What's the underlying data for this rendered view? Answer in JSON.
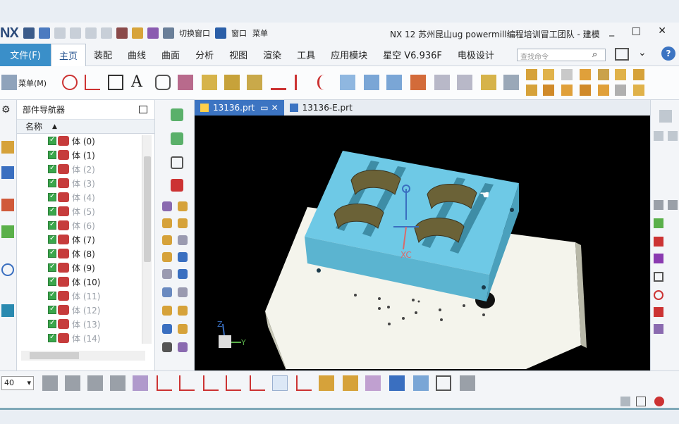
{
  "app": {
    "logo": "NX",
    "title": "NX 12 苏州昆山ug powermill编程培训冒工团队 - 建模",
    "quick_switch_window": "切换窗口",
    "quick_window": "窗口",
    "quick_menu": "菜单"
  },
  "menu": {
    "file": "文件(F)",
    "tabs": [
      "主页",
      "装配",
      "曲线",
      "曲面",
      "分析",
      "视图",
      "渲染",
      "工具",
      "应用模块",
      "星空 V6.936F",
      "电极设计"
    ],
    "active_tab": "主页",
    "search_placeholder": "查找命令"
  },
  "ribbon": {
    "menu_label": "菜单(M)"
  },
  "navigator": {
    "title": "部件导航器",
    "column_name": "名称",
    "rows": [
      {
        "label": "体 (0)",
        "gray": false
      },
      {
        "label": "体 (1)",
        "gray": false
      },
      {
        "label": "体 (2)",
        "gray": true
      },
      {
        "label": "体 (3)",
        "gray": true
      },
      {
        "label": "体 (4)",
        "gray": true
      },
      {
        "label": "体 (5)",
        "gray": true
      },
      {
        "label": "体 (6)",
        "gray": true
      },
      {
        "label": "体 (7)",
        "gray": false
      },
      {
        "label": "体 (8)",
        "gray": false
      },
      {
        "label": "体 (9)",
        "gray": false
      },
      {
        "label": "体 (10)",
        "gray": false
      },
      {
        "label": "体 (11)",
        "gray": true
      },
      {
        "label": "体 (12)",
        "gray": true
      },
      {
        "label": "体 (13)",
        "gray": true
      },
      {
        "label": "体 (14)",
        "gray": true
      }
    ]
  },
  "documents": {
    "tabs": [
      "13136.prt",
      "13136-E.prt"
    ],
    "active": "13136.prt"
  },
  "viewport": {
    "xc_label": "XC",
    "axis_z": "Z",
    "axis_y": "Y"
  },
  "bottom": {
    "zoom_value": "40"
  },
  "colors": {
    "file_button": "#3a8fc9",
    "mold_plate": "#6ec9e6",
    "base_plate": "#f2f2ea",
    "inserts": "#6b6237"
  }
}
